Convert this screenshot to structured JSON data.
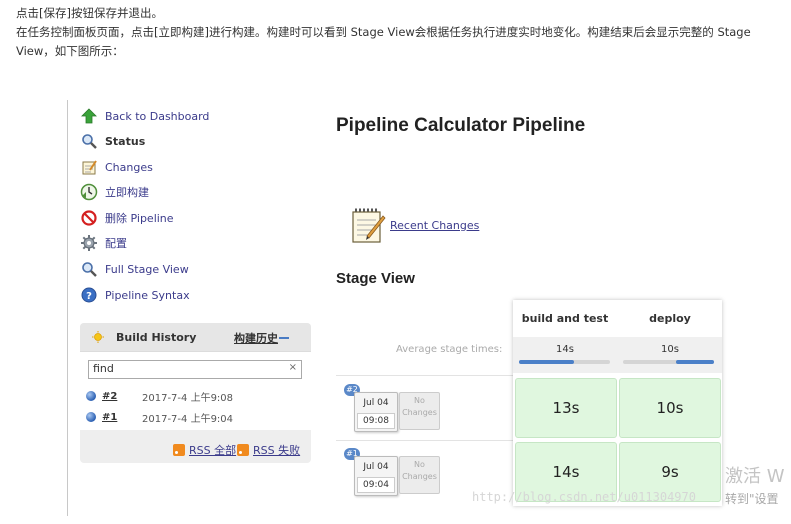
{
  "intro": {
    "line1": "点击[保存]按钮保存并退出。",
    "line2": "在任务控制面板页面，点击[立即构建]进行构建。构建时可以看到 Stage View会根据任务执行进度实时地变化。构建结束后会显示完整的 Stage View，如下图所示："
  },
  "sidebar": {
    "items": [
      {
        "label": "Back to Dashboard",
        "icon": "up-arrow-icon"
      },
      {
        "label": "Status",
        "icon": "magnifier-icon"
      },
      {
        "label": "Changes",
        "icon": "notepad-icon"
      },
      {
        "label": "立即构建",
        "icon": "build-clock-icon"
      },
      {
        "label": "删除 Pipeline",
        "icon": "no-entry-icon"
      },
      {
        "label": "配置",
        "icon": "gear-icon"
      },
      {
        "label": "Full Stage View",
        "icon": "magnifier-icon"
      },
      {
        "label": "Pipeline Syntax",
        "icon": "help-icon"
      }
    ]
  },
  "build_history": {
    "title": "Build History",
    "trend_link": "构建历史",
    "search": {
      "value": "find"
    },
    "builds": [
      {
        "number": "#2",
        "date": "2017-7-4 上午9:08"
      },
      {
        "number": "#1",
        "date": "2017-7-4 上午9:04"
      }
    ],
    "rss_all": "RSS 全部",
    "rss_fail": "RSS 失败"
  },
  "main": {
    "title": "Pipeline Calculator Pipeline",
    "recent_changes": "Recent Changes",
    "stage_view_title": "Stage View"
  },
  "stage_view": {
    "avg_label": "Average stage times:",
    "stages": [
      {
        "name": "build and test",
        "avg": "14s",
        "avg_fraction": 0.6
      },
      {
        "name": "deploy",
        "avg": "10s",
        "avg_fraction": 0.42
      }
    ],
    "runs": [
      {
        "badge": "#2",
        "date": "Jul 04",
        "time": "09:08",
        "changes": "No Changes",
        "durations": [
          "13s",
          "10s"
        ]
      },
      {
        "badge": "#1",
        "date": "Jul 04",
        "time": "09:04",
        "changes": "No Changes",
        "durations": [
          "14s",
          "9s"
        ]
      }
    ]
  },
  "watermark": {
    "url": "http://blog.csdn.net/u011304970",
    "activate_line1": "激活 W",
    "activate_line2": "转到\"设置"
  },
  "colors": {
    "success_cell": "#e0f7df",
    "progress_fill": "#4b80c8",
    "link": "#3b3b8b"
  }
}
